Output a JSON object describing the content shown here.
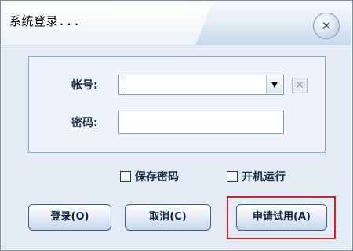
{
  "window": {
    "title": "系统登录...",
    "close_icon": "close-icon"
  },
  "form": {
    "account_label": "帐号:",
    "account_value": "",
    "dropdown_icon": "dropdown-arrow-icon",
    "clear_icon": "clear-x-icon",
    "password_label": "密码:",
    "password_value": ""
  },
  "options": {
    "save_password_label": "保存密码",
    "save_password_checked": false,
    "autostart_label": "开机运行",
    "autostart_checked": false
  },
  "buttons": {
    "login_label": "登录(O)",
    "cancel_label": "取消(C)",
    "trial_label": "申请试用(A)"
  },
  "colors": {
    "highlight": "#c8262b",
    "window_border": "#6f8fb8",
    "panel_bg": "#e4ebf5"
  }
}
